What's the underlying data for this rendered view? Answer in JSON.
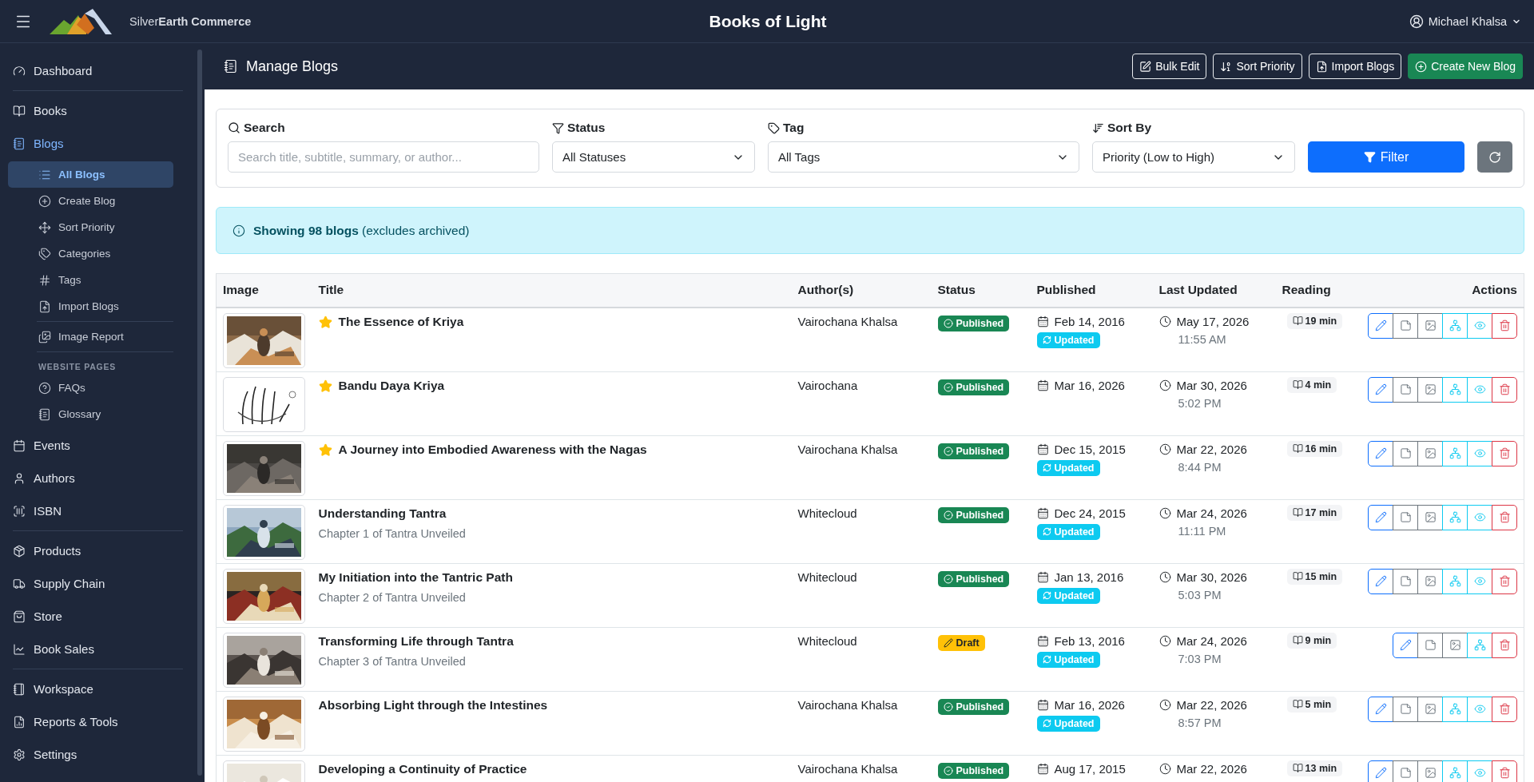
{
  "top_bar": {
    "brand": "Silver**Earth Commerce**",
    "title": "Books of Light",
    "user": "Michael Khalsa"
  },
  "sidebar": {
    "sections": [
      {
        "items": [
          {
            "label": "Dashboard",
            "selected": false
          }
        ]
      },
      {
        "items": [
          {
            "label": "Books",
            "selected": false
          },
          {
            "label": "Blogs",
            "selected": true,
            "groups": [
              {
                "items": [
                  {
                    "label": "All Blogs",
                    "selected": true
                  },
                  {
                    "label": "Create Blog",
                    "selected": false
                  },
                  {
                    "label": "Sort Priority",
                    "selected": false
                  },
                  {
                    "label": "Categories",
                    "selected": false
                  },
                  {
                    "label": "Tags",
                    "selected": false
                  },
                  {
                    "label": "Import Blogs",
                    "selected": false
                  }
                ]
              },
              {
                "items": [
                  {
                    "label": "Image Report",
                    "selected": false
                  }
                ]
              },
              {
                "heading": "WEBSITE PAGES",
                "items": [
                  {
                    "label": "FAQs",
                    "selected": false
                  },
                  {
                    "label": "Glossary",
                    "selected": false
                  }
                ]
              }
            ]
          },
          {
            "label": "Events",
            "selected": false
          },
          {
            "label": "Authors",
            "selected": false
          },
          {
            "label": "ISBN",
            "selected": false
          }
        ]
      },
      {
        "items": [
          {
            "label": "Products",
            "selected": false
          },
          {
            "label": "Supply Chain",
            "selected": false
          },
          {
            "label": "Store",
            "selected": false
          },
          {
            "label": "Book Sales",
            "selected": false
          }
        ]
      },
      {
        "items": [
          {
            "label": "Workspace",
            "selected": false
          },
          {
            "label": "Reports & Tools",
            "selected": false
          },
          {
            "label": "Settings",
            "selected": false
          }
        ]
      }
    ]
  },
  "page_header": {
    "title": "Manage Blogs",
    "actions": [
      {
        "label": "Bulk Edit",
        "kind": "outline"
      },
      {
        "label": "Sort Priority",
        "kind": "outline"
      },
      {
        "label": "Import Blogs",
        "kind": "outline"
      },
      {
        "label": "Create New Blog",
        "kind": "primary"
      }
    ]
  },
  "filters": {
    "search": {
      "label": "Search",
      "placeholder": "Search title, subtitle, summary, or author..."
    },
    "status": {
      "label": "Status",
      "value": "All Statuses"
    },
    "tag": {
      "label": "Tag",
      "value": "All Tags"
    },
    "sort_by": {
      "label": "Sort By",
      "value": "Priority (Low to High)"
    },
    "filter_button": "Filter"
  },
  "alert": "**Showing 98 blogs** (excludes archived)",
  "table": {
    "columns": [
      "Image",
      "Title",
      "Author(s)",
      "Status",
      "Published",
      "Last Updated",
      "Reading",
      "Actions"
    ],
    "rows": [
      {
        "featured": true,
        "title": "The Essence of Kriya",
        "author": "Vairochana Khalsa",
        "status": {
          "kind": "published",
          "label": "Published"
        },
        "published": "Feb 14, 2016",
        "updated": true,
        "updated_label": "Updated",
        "last_updated": "May 17, 2026",
        "last_updated_time": "11:55 AM",
        "reading": "19 min",
        "previewable": true
      },
      {
        "featured": true,
        "title": "Bandu Daya Kriya",
        "author": "Vairochana",
        "status": {
          "kind": "published",
          "label": "Published"
        },
        "published": "Mar 16, 2026",
        "updated": false,
        "last_updated": "Mar 30, 2026",
        "last_updated_time": "5:02 PM",
        "reading": "4 min",
        "previewable": true
      },
      {
        "featured": true,
        "title": "A Journey into Embodied Awareness with the Nagas",
        "author": "Vairochana Khalsa",
        "status": {
          "kind": "published",
          "label": "Published"
        },
        "published": "Dec 15, 2015",
        "updated": true,
        "updated_label": "Updated",
        "last_updated": "Mar 22, 2026",
        "last_updated_time": "8:44 PM",
        "reading": "16 min",
        "previewable": true
      },
      {
        "featured": false,
        "title": "Understanding Tantra",
        "subtitle": "Chapter 1 of Tantra Unveiled",
        "author": "Whitecloud",
        "status": {
          "kind": "published",
          "label": "Published"
        },
        "published": "Dec 24, 2015",
        "updated": true,
        "updated_label": "Updated",
        "last_updated": "Mar 24, 2026",
        "last_updated_time": "11:11 PM",
        "reading": "17 min",
        "previewable": true
      },
      {
        "featured": false,
        "title": "My Initiation into the Tantric Path",
        "subtitle": "Chapter 2 of Tantra Unveiled",
        "author": "Whitecloud",
        "status": {
          "kind": "published",
          "label": "Published"
        },
        "published": "Jan 13, 2016",
        "updated": true,
        "updated_label": "Updated",
        "last_updated": "Mar 30, 2026",
        "last_updated_time": "5:03 PM",
        "reading": "15 min",
        "previewable": true
      },
      {
        "featured": false,
        "title": "Transforming Life through Tantra",
        "subtitle": "Chapter 3 of Tantra Unveiled",
        "author": "Whitecloud",
        "status": {
          "kind": "draft",
          "label": "Draft"
        },
        "published": "Feb 13, 2016",
        "updated": true,
        "updated_label": "Updated",
        "last_updated": "Mar 24, 2026",
        "last_updated_time": "7:03 PM",
        "reading": "9 min",
        "previewable": false
      },
      {
        "featured": false,
        "title": "Absorbing Light through the Intestines",
        "author": "Vairochana Khalsa",
        "status": {
          "kind": "published",
          "label": "Published"
        },
        "published": "Mar 16, 2026",
        "updated": true,
        "updated_label": "Updated",
        "last_updated": "Mar 22, 2026",
        "last_updated_time": "8:57 PM",
        "reading": "5 min",
        "previewable": true
      },
      {
        "featured": false,
        "title": "Developing a Continuity of Practice",
        "author": "Vairochana Khalsa",
        "status": {
          "kind": "published",
          "label": "Published"
        },
        "published": "Aug 17, 2015",
        "updated": false,
        "last_updated": "Mar 22, 2026",
        "reading": "13 min",
        "previewable": true
      }
    ]
  }
}
